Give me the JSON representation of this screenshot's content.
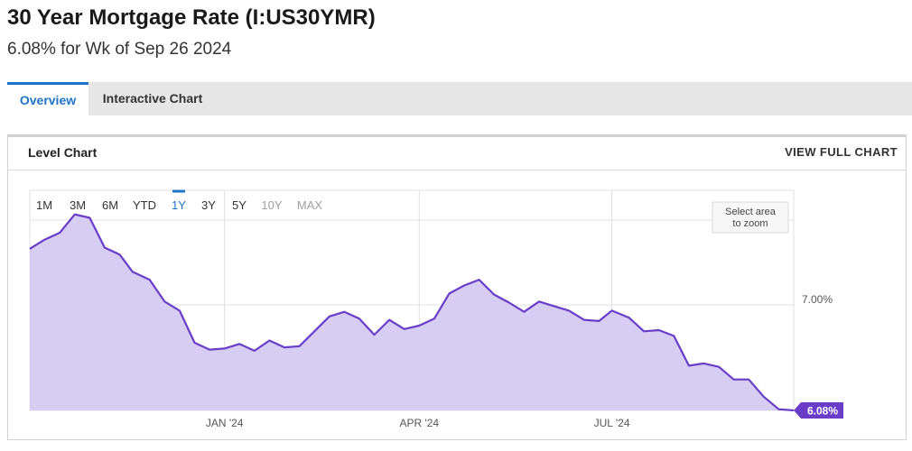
{
  "page": {
    "title": "30 Year Mortgage Rate (I:US30YMR)",
    "subtitle": "6.08% for Wk of Sep 26 2024"
  },
  "tabs": [
    {
      "label": "Overview",
      "active": true
    },
    {
      "label": "Interactive Chart",
      "active": false
    }
  ],
  "card": {
    "title": "Level Chart",
    "full_chart_label": "VIEW FULL CHART"
  },
  "range_buttons": [
    {
      "label": "1M",
      "state": "normal"
    },
    {
      "label": "3M",
      "state": "normal"
    },
    {
      "label": "6M",
      "state": "normal"
    },
    {
      "label": "YTD",
      "state": "normal"
    },
    {
      "label": "1Y",
      "state": "active"
    },
    {
      "label": "3Y",
      "state": "normal"
    },
    {
      "label": "5Y",
      "state": "normal"
    },
    {
      "label": "10Y",
      "state": "disabled"
    },
    {
      "label": "MAX",
      "state": "disabled"
    }
  ],
  "zoom_hint": [
    "Select area",
    "to zoom"
  ],
  "colors": {
    "line": "#6a3dc9",
    "area": "#d7ccf1",
    "accent_blue": "#1f73c9",
    "grid": "#e0e0e0"
  },
  "chart_data": {
    "type": "area",
    "x": [
      "2023-10-05",
      "2023-10-12",
      "2023-10-19",
      "2023-10-26",
      "2023-11-02",
      "2023-11-09",
      "2023-11-16",
      "2023-11-22",
      "2023-11-30",
      "2023-12-07",
      "2023-12-14",
      "2023-12-21",
      "2023-12-28",
      "2024-01-04",
      "2024-01-11",
      "2024-01-18",
      "2024-01-25",
      "2024-02-01",
      "2024-02-08",
      "2024-02-15",
      "2024-02-22",
      "2024-02-29",
      "2024-03-07",
      "2024-03-14",
      "2024-03-21",
      "2024-03-28",
      "2024-04-04",
      "2024-04-11",
      "2024-04-18",
      "2024-04-25",
      "2024-05-02",
      "2024-05-09",
      "2024-05-16",
      "2024-05-23",
      "2024-05-30",
      "2024-06-06",
      "2024-06-13",
      "2024-06-20",
      "2024-06-27",
      "2024-07-03",
      "2024-07-11",
      "2024-07-18",
      "2024-07-25",
      "2024-08-01",
      "2024-08-08",
      "2024-08-15",
      "2024-08-22",
      "2024-08-29",
      "2024-09-05",
      "2024-09-12",
      "2024-09-19",
      "2024-09-26"
    ],
    "values": [
      7.49,
      7.57,
      7.63,
      7.79,
      7.76,
      7.5,
      7.44,
      7.29,
      7.22,
      7.03,
      6.95,
      6.67,
      6.61,
      6.62,
      6.66,
      6.6,
      6.69,
      6.63,
      6.64,
      6.77,
      6.9,
      6.94,
      6.88,
      6.74,
      6.87,
      6.79,
      6.82,
      6.88,
      7.1,
      7.17,
      7.22,
      7.09,
      7.02,
      6.94,
      7.03,
      6.99,
      6.95,
      6.87,
      6.86,
      6.95,
      6.89,
      6.77,
      6.78,
      6.73,
      6.47,
      6.49,
      6.46,
      6.35,
      6.35,
      6.2,
      6.09,
      6.08
    ],
    "x_ticks": [
      {
        "date": "2024-01-04",
        "label": "JAN '24"
      },
      {
        "date": "2024-04-04",
        "label": "APR '24"
      },
      {
        "date": "2024-07-03",
        "label": "JUL '24"
      }
    ],
    "y_ticks": [
      {
        "value": 7.0,
        "label": "7.00%"
      }
    ],
    "ylim": [
      6.08,
      8.0
    ],
    "last_value_label": "6.08%",
    "grid": true
  }
}
